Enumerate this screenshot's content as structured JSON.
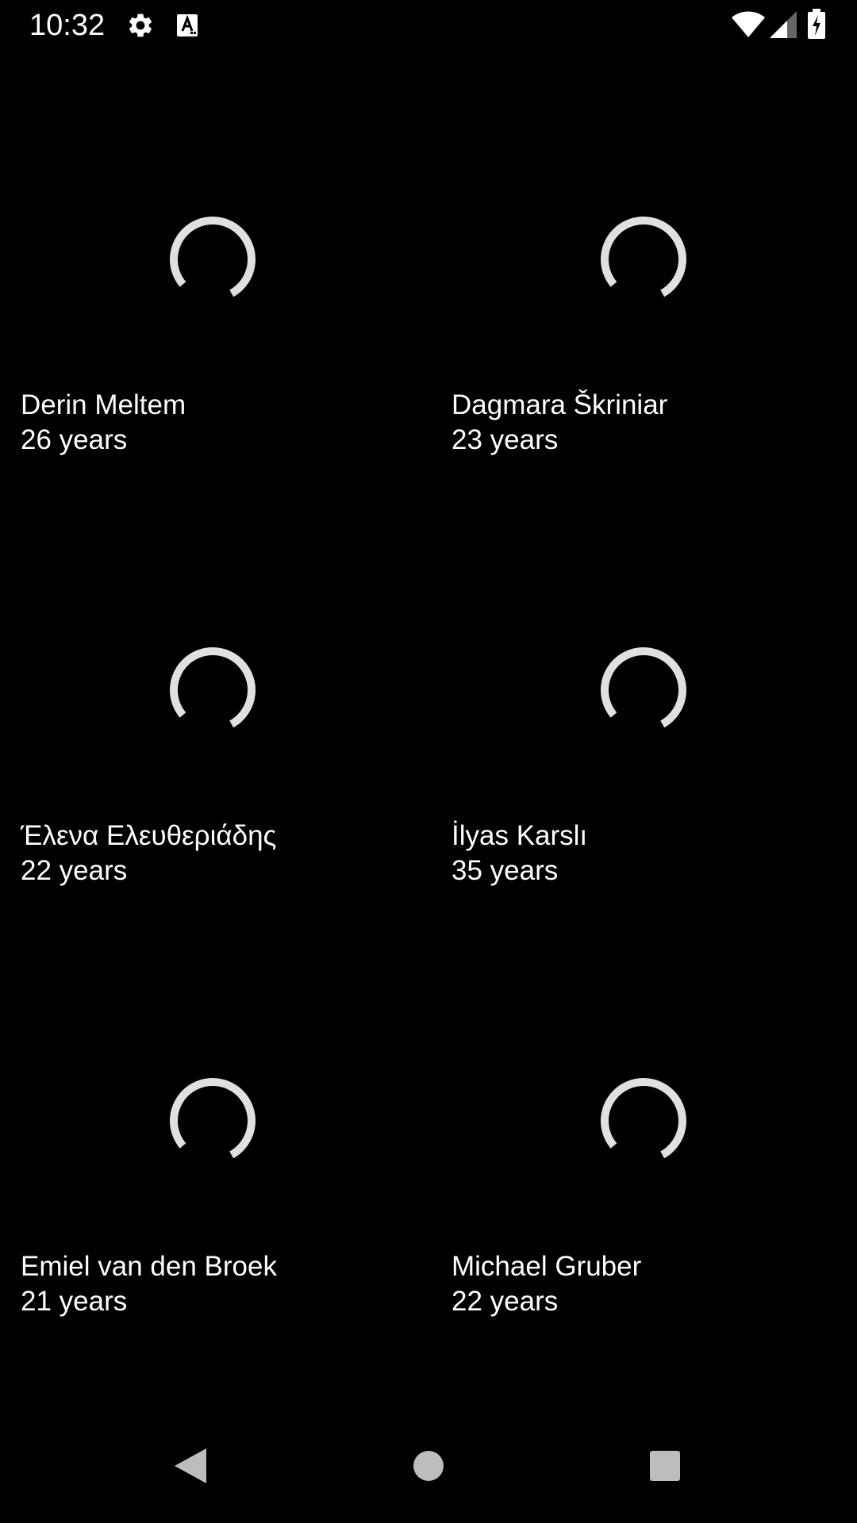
{
  "status_bar": {
    "time": "10:32",
    "icons": [
      "gear-icon",
      "text-a-icon",
      "wifi-icon",
      "signal-icon",
      "battery-charging-icon"
    ]
  },
  "people": [
    {
      "name": "Derin Meltem",
      "age": "26 years"
    },
    {
      "name": "Dagmara Škriniar",
      "age": "23 years"
    },
    {
      "name": "Έλενα Ελευθεριάδης",
      "age": "22 years"
    },
    {
      "name": "İlyas Karslı",
      "age": "35 years"
    },
    {
      "name": "Emiel van den Broek",
      "age": "21 years"
    },
    {
      "name": "Michael Gruber",
      "age": "22 years"
    }
  ],
  "nav_bar": {
    "icons": [
      "back-icon",
      "home-icon",
      "recents-icon"
    ]
  },
  "colors": {
    "background": "#000000",
    "text": "#ffffff",
    "spinner": "#e0e0e0",
    "nav_icons": "#bdbdbd"
  }
}
